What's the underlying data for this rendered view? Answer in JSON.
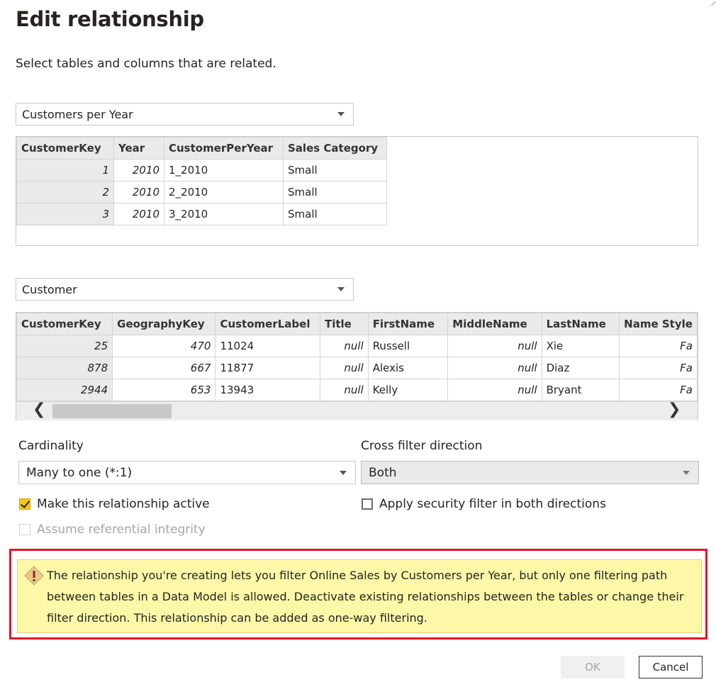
{
  "dialog": {
    "title": "Edit relationship",
    "subtitle": "Select tables and columns that are related."
  },
  "table1": {
    "selected": "Customers per Year",
    "columns": [
      "CustomerKey",
      "Year",
      "CustomerPerYear",
      "Sales Category"
    ],
    "rows": [
      [
        "1",
        "2010",
        "1_2010",
        "Small"
      ],
      [
        "2",
        "2010",
        "2_2010",
        "Small"
      ],
      [
        "3",
        "2010",
        "3_2010",
        "Small"
      ]
    ]
  },
  "table2": {
    "selected": "Customer",
    "columns": [
      "CustomerKey",
      "GeographyKey",
      "CustomerLabel",
      "Title",
      "FirstName",
      "MiddleName",
      "LastName",
      "Name Style"
    ],
    "rows": [
      [
        "25",
        "470",
        "11024",
        "null",
        "Russell",
        "null",
        "Xie",
        "Fa"
      ],
      [
        "878",
        "667",
        "11877",
        "null",
        "Alexis",
        "null",
        "Diaz",
        "Fa"
      ],
      [
        "2944",
        "653",
        "13943",
        "null",
        "Kelly",
        "null",
        "Bryant",
        "Fa"
      ]
    ]
  },
  "cardinality": {
    "label": "Cardinality",
    "value": "Many to one (*:1)"
  },
  "cross_filter": {
    "label": "Cross filter direction",
    "value": "Both"
  },
  "options": {
    "make_active": "Make this relationship active",
    "referential_integrity": "Assume referential integrity",
    "security_filter": "Apply security filter in both directions"
  },
  "warning": {
    "text": "The relationship you're creating lets you filter Online Sales by Customers per Year, but only one filtering path between tables in a Data Model is allowed. Deactivate existing relationships between the tables or change their filter direction. This relationship can be added as one-way filtering."
  },
  "buttons": {
    "ok": "OK",
    "cancel": "Cancel"
  },
  "colors": {
    "accent": "#f2c811",
    "warning_bg": "#fcf8a8",
    "highlight_border": "#e81123"
  }
}
